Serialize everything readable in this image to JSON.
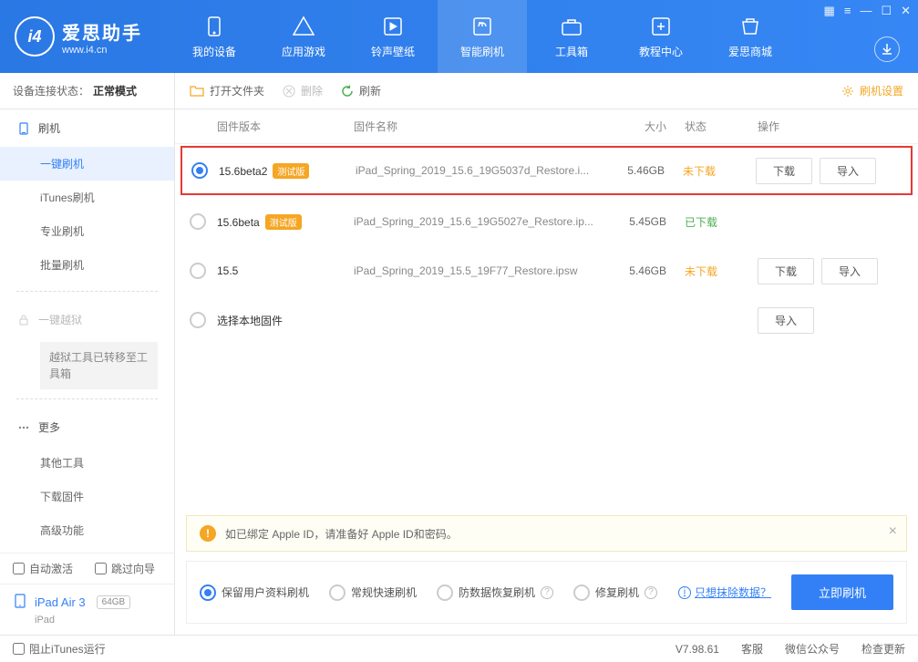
{
  "app": {
    "title": "爱思助手",
    "url": "www.i4.cn"
  },
  "nav": [
    {
      "label": "我的设备"
    },
    {
      "label": "应用游戏"
    },
    {
      "label": "铃声壁纸"
    },
    {
      "label": "智能刷机"
    },
    {
      "label": "工具箱"
    },
    {
      "label": "教程中心"
    },
    {
      "label": "爱思商城"
    }
  ],
  "sidebar": {
    "status_label": "设备连接状态：",
    "status_value": "正常模式",
    "flash": {
      "head": "刷机",
      "items": [
        "一键刷机",
        "iTunes刷机",
        "专业刷机",
        "批量刷机"
      ]
    },
    "jailbreak": {
      "head": "一键越狱",
      "note": "越狱工具已转移至工具箱"
    },
    "more": {
      "head": "更多",
      "items": [
        "其他工具",
        "下载固件",
        "高级功能"
      ]
    },
    "chk_auto": "自动激活",
    "chk_skip": "跳过向导",
    "device": {
      "name": "iPad Air 3",
      "capacity": "64GB",
      "type": "iPad"
    }
  },
  "toolbar": {
    "open": "打开文件夹",
    "delete": "删除",
    "refresh": "刷新",
    "settings": "刷机设置"
  },
  "columns": {
    "version": "固件版本",
    "name": "固件名称",
    "size": "大小",
    "status": "状态",
    "ops": "操作"
  },
  "rows": [
    {
      "version": "15.6beta2",
      "beta": "测试版",
      "name": "iPad_Spring_2019_15.6_19G5037d_Restore.i...",
      "size": "5.46GB",
      "status": "未下载",
      "status_cls": "orange",
      "selected": true,
      "highlighted": true,
      "ops": [
        "下载",
        "导入"
      ]
    },
    {
      "version": "15.6beta",
      "beta": "测试版",
      "name": "iPad_Spring_2019_15.6_19G5027e_Restore.ip...",
      "size": "5.45GB",
      "status": "已下载",
      "status_cls": "green",
      "selected": false,
      "ops": []
    },
    {
      "version": "15.5",
      "beta": null,
      "name": "iPad_Spring_2019_15.5_19F77_Restore.ipsw",
      "size": "5.46GB",
      "status": "未下载",
      "status_cls": "orange",
      "selected": false,
      "ops": [
        "下载",
        "导入"
      ]
    },
    {
      "version": "选择本地固件",
      "beta": null,
      "name": "",
      "size": "",
      "status": "",
      "status_cls": "",
      "selected": false,
      "ops": [
        "导入"
      ]
    }
  ],
  "warning": "如已绑定 Apple ID，请准备好 Apple ID和密码。",
  "options": {
    "items": [
      "保留用户资料刷机",
      "常规快速刷机",
      "防数据恢复刷机",
      "修复刷机"
    ],
    "selected": 0,
    "link": "只想抹除数据？",
    "primary": "立即刷机"
  },
  "footer": {
    "block_itunes": "阻止iTunes运行",
    "version": "V7.98.61",
    "service": "客服",
    "wechat": "微信公众号",
    "update": "检查更新"
  }
}
